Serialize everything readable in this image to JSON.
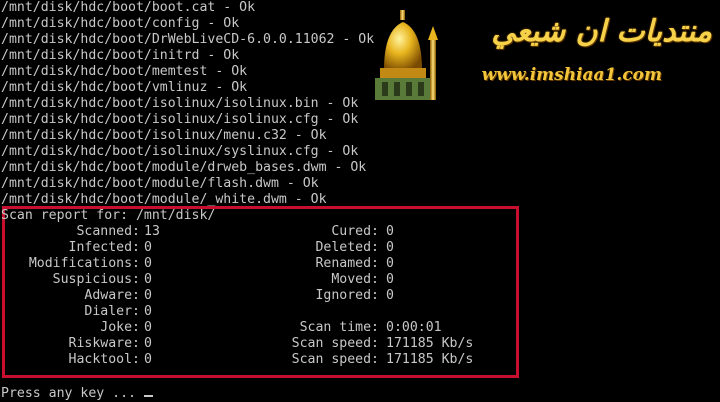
{
  "file_lines": [
    "/mnt/disk/hdc/boot/boot.cat - Ok",
    "/mnt/disk/hdc/boot/config - Ok",
    "/mnt/disk/hdc/boot/DrWebLiveCD-6.0.0.11062 - Ok",
    "/mnt/disk/hdc/boot/initrd - Ok",
    "/mnt/disk/hdc/boot/memtest - Ok",
    "/mnt/disk/hdc/boot/vmlinuz - Ok",
    "/mnt/disk/hdc/boot/isolinux/isolinux.bin - Ok",
    "/mnt/disk/hdc/boot/isolinux/isolinux.cfg - Ok",
    "/mnt/disk/hdc/boot/isolinux/menu.c32 - Ok",
    "/mnt/disk/hdc/boot/isolinux/syslinux.cfg - Ok",
    "/mnt/disk/hdc/boot/module/drweb_bases.dwm - Ok",
    "/mnt/disk/hdc/boot/module/flash.dwm - Ok",
    "/mnt/disk/hdc/boot/module/_white.dwm - Ok"
  ],
  "report": {
    "header": "Scan report for: /mnt/disk/",
    "left": [
      {
        "label": "Scanned:",
        "value": "13"
      },
      {
        "label": "Infected:",
        "value": "0"
      },
      {
        "label": "Modifications:",
        "value": "0"
      },
      {
        "label": "Suspicious:",
        "value": "0"
      },
      {
        "label": "Adware:",
        "value": "0"
      },
      {
        "label": "Dialer:",
        "value": "0"
      },
      {
        "label": "Joke:",
        "value": "0"
      },
      {
        "label": "Riskware:",
        "value": "0"
      },
      {
        "label": "Hacktool:",
        "value": "0"
      }
    ],
    "right": [
      {
        "label": "Cured:",
        "value": "0"
      },
      {
        "label": "Deleted:",
        "value": "0"
      },
      {
        "label": "Renamed:",
        "value": "0"
      },
      {
        "label": "Moved:",
        "value": "0"
      },
      {
        "label": "Ignored:",
        "value": "0"
      },
      {
        "label": "",
        "value": ""
      },
      {
        "label": "Scan time:",
        "value": "0:00:01"
      },
      {
        "label": "Scan speed:",
        "value": "171185 Kb/s"
      },
      {
        "label": "Scan speed:",
        "value": "171185 Kb/s"
      }
    ],
    "highlight_color": "#c8102e"
  },
  "prompt": "Press any key ...",
  "watermark": {
    "arabic": "منتديات ان شيعي",
    "url": "www.imshiaa1.com",
    "icon": "shrine-dome-icon"
  }
}
